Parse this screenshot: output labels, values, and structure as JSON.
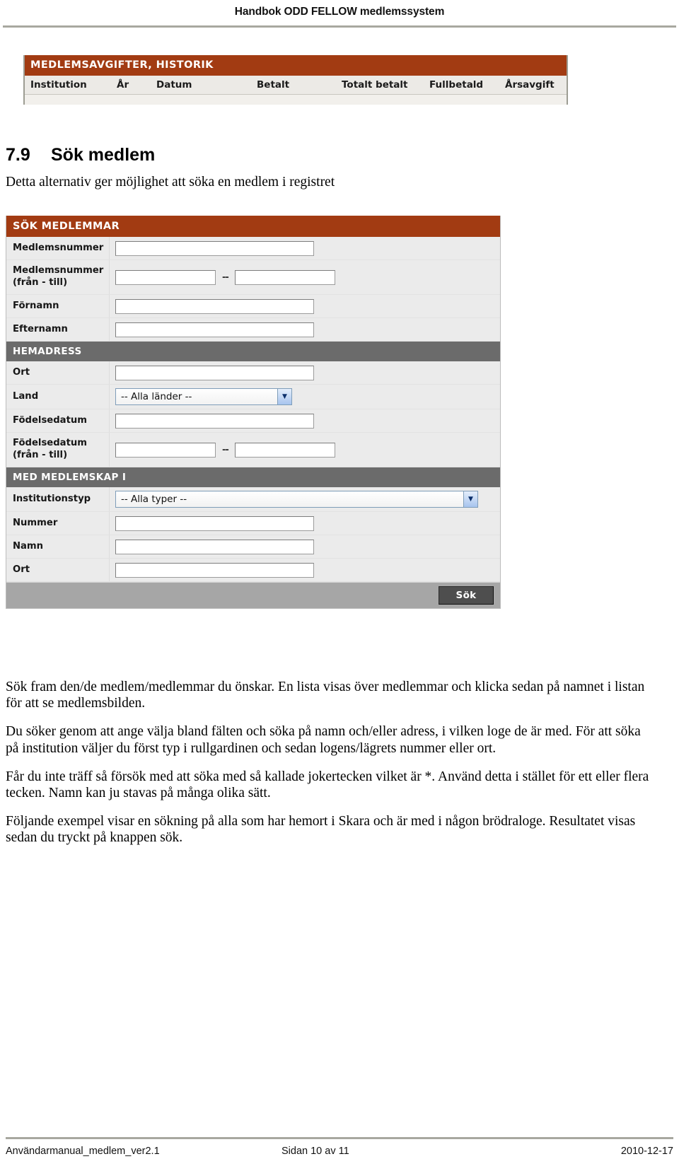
{
  "header": {
    "title": "Handbok ODD FELLOW medlemssystem"
  },
  "top_screenshot": {
    "title": "MEDLEMSAVGIFTER, HISTORIK",
    "columns": [
      "Institution",
      "År",
      "Datum",
      "Betalt",
      "Totalt betalt",
      "Fullbetald",
      "Årsavgift"
    ]
  },
  "section": {
    "number": "7.9",
    "heading": "Sök medlem",
    "lead": "Detta alternativ ger möjlighet att söka en medlem i registret"
  },
  "search_form": {
    "title": "SÖK MEDLEMMAR",
    "fields": [
      {
        "label": "Medlemsnummer",
        "type": "text",
        "value": ""
      },
      {
        "label_line1": "Medlemsnummer",
        "label_line2": "(från - till)",
        "type": "range",
        "from": "",
        "to": "",
        "separator": "--"
      },
      {
        "label": "Förnamn",
        "type": "text",
        "value": ""
      },
      {
        "label": "Efternamn",
        "type": "text",
        "value": ""
      }
    ],
    "section_hemadress": {
      "title": "HEMADRESS",
      "fields": [
        {
          "label": "Ort",
          "type": "text",
          "value": ""
        },
        {
          "label": "Land",
          "type": "select",
          "value": "-- Alla länder --"
        },
        {
          "label": "Födelsedatum",
          "type": "text",
          "value": ""
        },
        {
          "label_line1": "Födelsedatum",
          "label_line2": "(från - till)",
          "type": "range",
          "from": "",
          "to": "",
          "separator": "--"
        }
      ]
    },
    "section_medlemskap": {
      "title": "MED MEDLEMSKAP I",
      "fields": [
        {
          "label": "Institutionstyp",
          "type": "select",
          "value": "-- Alla typer --"
        },
        {
          "label": "Nummer",
          "type": "text",
          "value": ""
        },
        {
          "label": "Namn",
          "type": "text",
          "value": ""
        },
        {
          "label": "Ort",
          "type": "text",
          "value": ""
        }
      ]
    },
    "submit_label": "Sök"
  },
  "body": {
    "p1": "Sök fram den/de medlem/medlemmar du önskar. En lista visas över medlemmar och klicka sedan på namnet i listan för att se medlemsbilden.",
    "p2": "Du söker genom att ange välja bland fälten och söka på namn och/eller adress, i vilken loge de är med. För att söka på institution väljer du först typ i rullgardinen och sedan logens/lägrets nummer eller ort.",
    "p3": "Får du inte träff så försök med att söka med så kallade jokertecken vilket är *. Använd detta i stället för ett eller flera tecken. Namn kan ju stavas på många olika sätt.",
    "p4": "Följande exempel visar en sökning på alla som har hemort i Skara och är med i någon brödraloge. Resultatet visas sedan du tryckt på knappen sök."
  },
  "footer": {
    "left": "Användarmanual_medlem_ver2.1",
    "center": "Sidan 10 av 11",
    "right": "2010-12-17"
  },
  "colors": {
    "brand_orange": "#a23b12",
    "section_gray": "#6b6b6b",
    "form_bg": "#ebebeb",
    "footer_bar": "#a6a6a6"
  }
}
